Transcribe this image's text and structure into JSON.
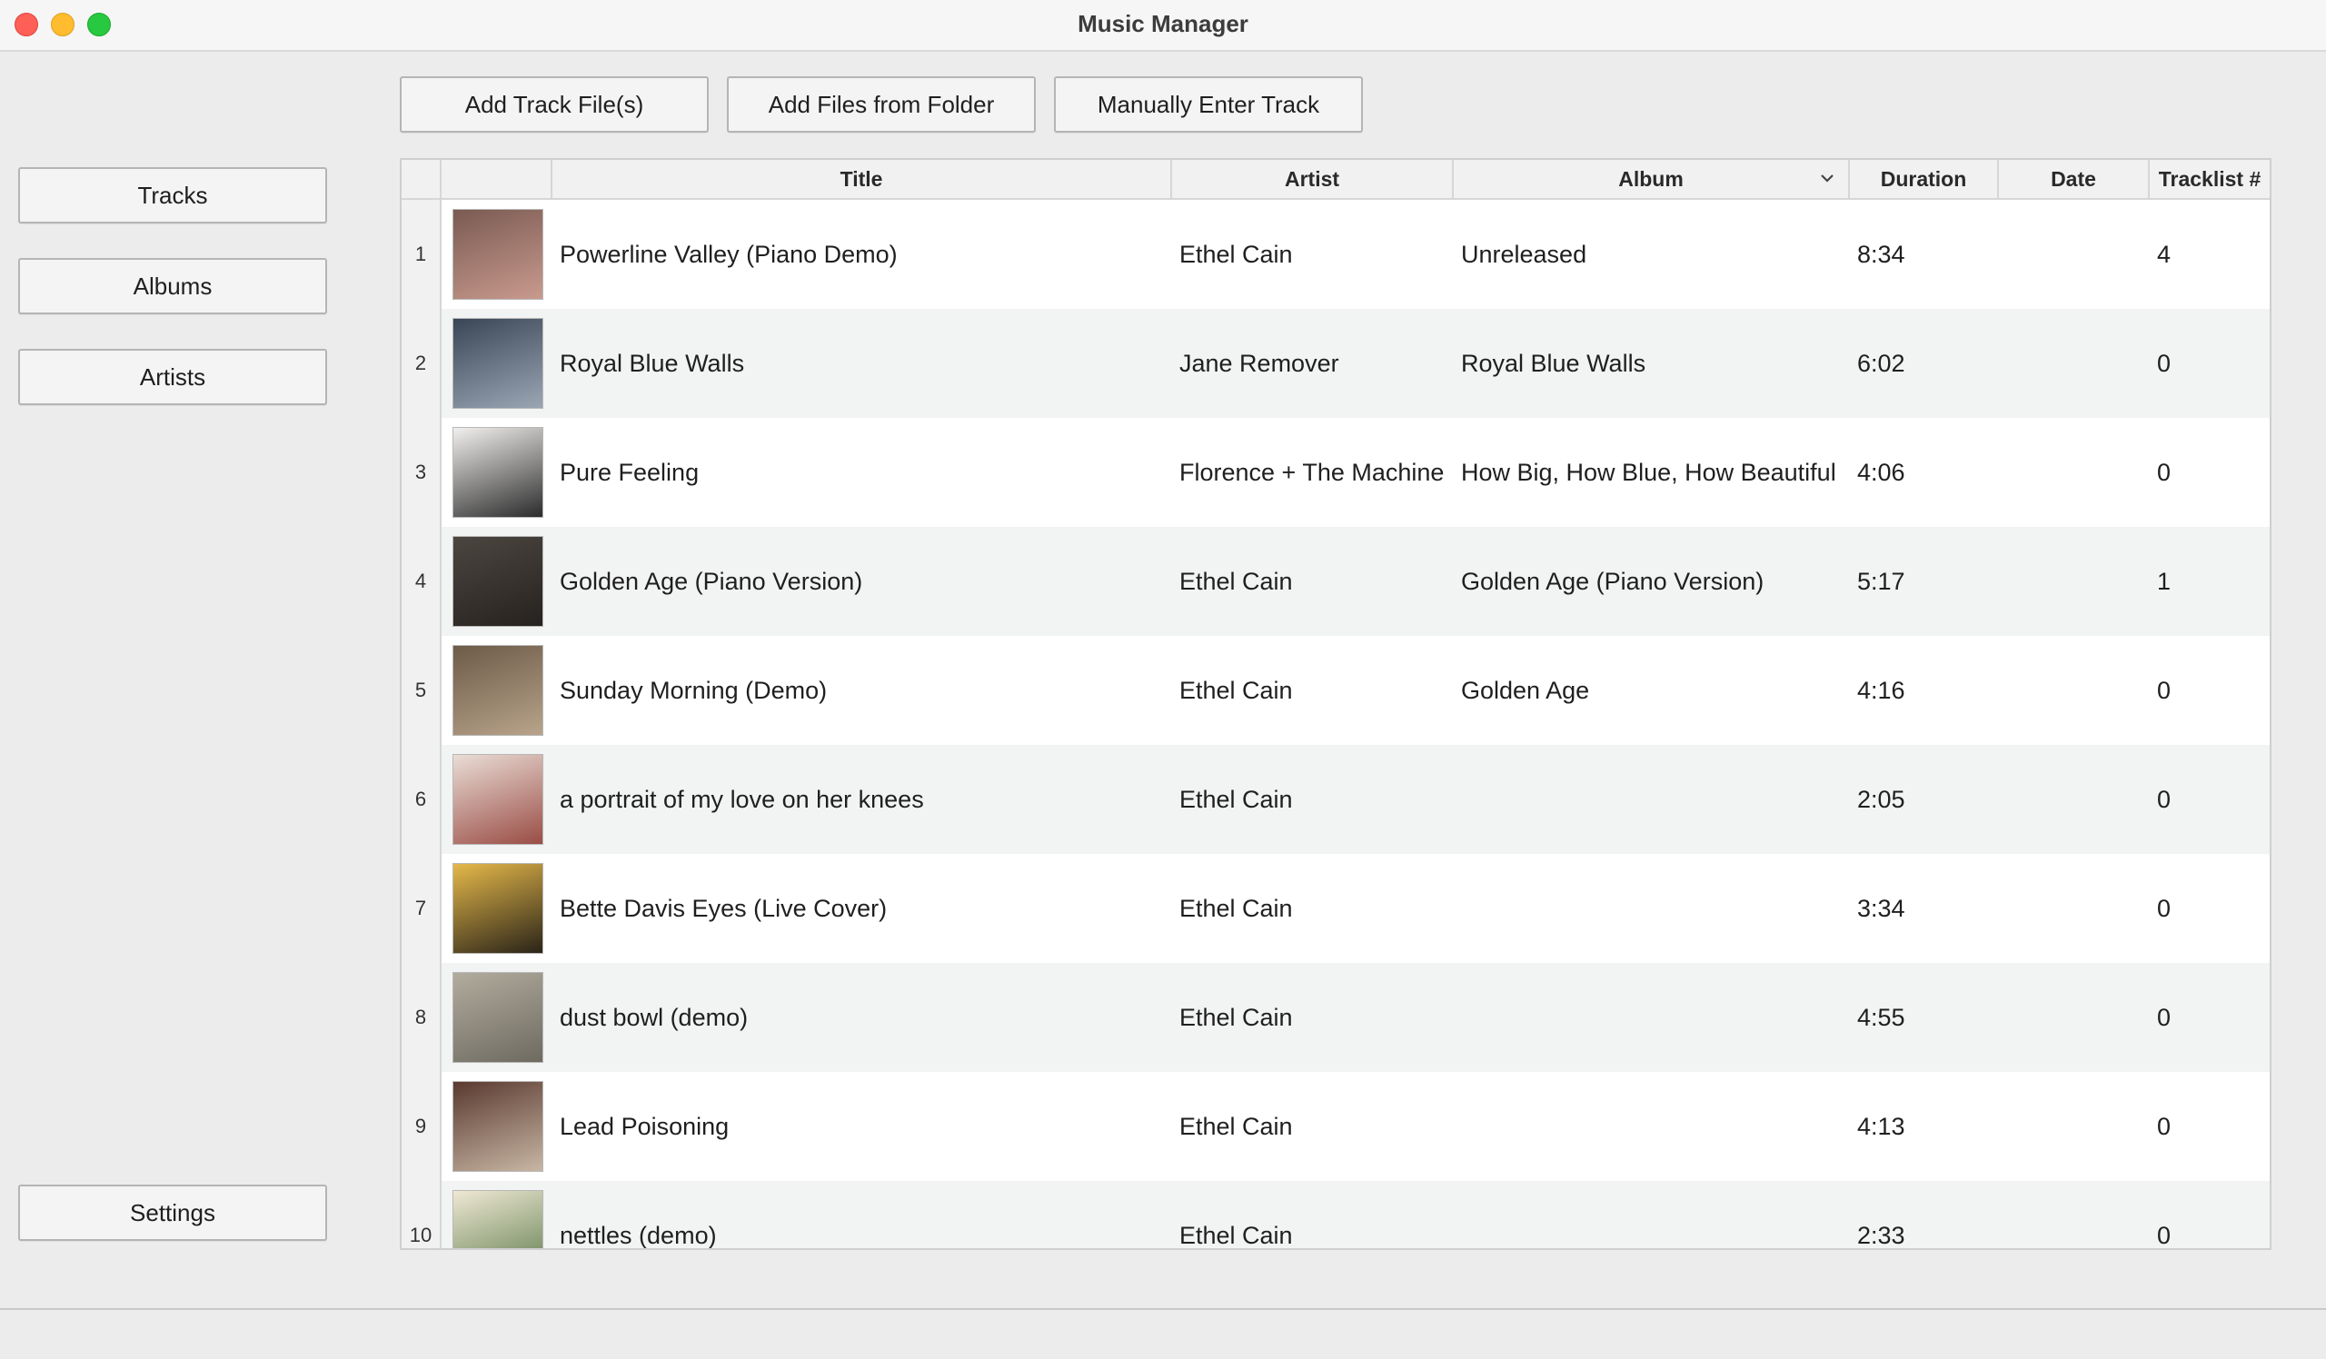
{
  "window": {
    "title": "Music Manager"
  },
  "sidebar": {
    "items": [
      {
        "label": "Tracks"
      },
      {
        "label": "Albums"
      },
      {
        "label": "Artists"
      }
    ],
    "settings_label": "Settings"
  },
  "toolbar": {
    "add_files_label": "Add Track File(s)",
    "add_folder_label": "Add Files from Folder",
    "manual_entry_label": "Manually Enter Track"
  },
  "table": {
    "sorted_column": "Album",
    "sort_indicator": "chevron-down-icon",
    "columns": [
      "Title",
      "Artist",
      "Album",
      "Duration",
      "Date",
      "Tracklist #"
    ],
    "rows": [
      {
        "num": "1",
        "title": "Powerline Valley (Piano Demo)",
        "artist": "Ethel Cain",
        "album": "Unreleased",
        "duration": "8:34",
        "date": "",
        "tracklist": "4",
        "art_colors": [
          "#7a5a52",
          "#c99a8e"
        ]
      },
      {
        "num": "2",
        "title": "Royal Blue Walls",
        "artist": "Jane Remover",
        "album": "Royal Blue Walls",
        "duration": "6:02",
        "date": "",
        "tracklist": "0",
        "art_colors": [
          "#3a4656",
          "#9aa6b4"
        ]
      },
      {
        "num": "3",
        "title": "Pure Feeling",
        "artist": "Florence + The Machine",
        "album": "How Big, How Blue, How Beautiful",
        "duration": "4:06",
        "date": "",
        "tracklist": "0",
        "art_colors": [
          "#f2f0ee",
          "#2c2c2c"
        ]
      },
      {
        "num": "4",
        "title": "Golden Age (Piano Version)",
        "artist": "Ethel Cain",
        "album": "Golden Age (Piano Version)",
        "duration": "5:17",
        "date": "",
        "tracklist": "1",
        "art_colors": [
          "#4c4640",
          "#26221f"
        ]
      },
      {
        "num": "5",
        "title": "Sunday Morning (Demo)",
        "artist": "Ethel Cain",
        "album": "Golden Age",
        "duration": "4:16",
        "date": "",
        "tracklist": "0",
        "art_colors": [
          "#6d5a48",
          "#b8a48a"
        ]
      },
      {
        "num": "6",
        "title": "a portrait of my love on her knees",
        "artist": "Ethel Cain",
        "album": "",
        "duration": "2:05",
        "date": "",
        "tracklist": "0",
        "art_colors": [
          "#e9ddd6",
          "#9a4d45"
        ]
      },
      {
        "num": "7",
        "title": "Bette Davis Eyes (Live Cover)",
        "artist": "Ethel Cain",
        "album": "",
        "duration": "3:34",
        "date": "",
        "tracklist": "0",
        "art_colors": [
          "#e5b84a",
          "#2a2418"
        ]
      },
      {
        "num": "8",
        "title": "dust bowl (demo)",
        "artist": "Ethel Cain",
        "album": "",
        "duration": "4:55",
        "date": "",
        "tracklist": "0",
        "art_colors": [
          "#b2ac9e",
          "#6e6a60"
        ]
      },
      {
        "num": "9",
        "title": "Lead Poisoning",
        "artist": "Ethel Cain",
        "album": "",
        "duration": "4:13",
        "date": "",
        "tracklist": "0",
        "art_colors": [
          "#5a3a30",
          "#c8b6a4"
        ]
      },
      {
        "num": "10",
        "title": "nettles (demo)",
        "artist": "Ethel Cain",
        "album": "",
        "duration": "2:33",
        "date": "",
        "tracklist": "0",
        "art_colors": [
          "#efe8d4",
          "#5c7a4a"
        ]
      }
    ]
  }
}
